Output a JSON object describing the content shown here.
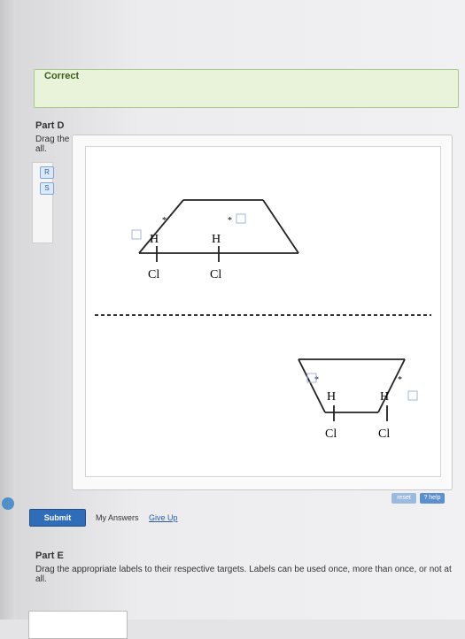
{
  "status": {
    "text": "Correct"
  },
  "part_d": {
    "title": "Part D",
    "instructions": "Drag the appropriate labels to their respective targets. Labels can be used once, more than once, or not at all."
  },
  "labels": [
    "R",
    "S"
  ],
  "molecule": {
    "h": "H",
    "cl": "Cl",
    "star": "*"
  },
  "controls": {
    "reset": "reset",
    "help": "? help",
    "submit": "Submit",
    "my_answers": "My Answers",
    "give_up": "Give Up"
  },
  "part_e": {
    "title": "Part E",
    "instructions": "Drag the appropriate labels to their respective targets. Labels can be used once, more than once, or not at all."
  }
}
